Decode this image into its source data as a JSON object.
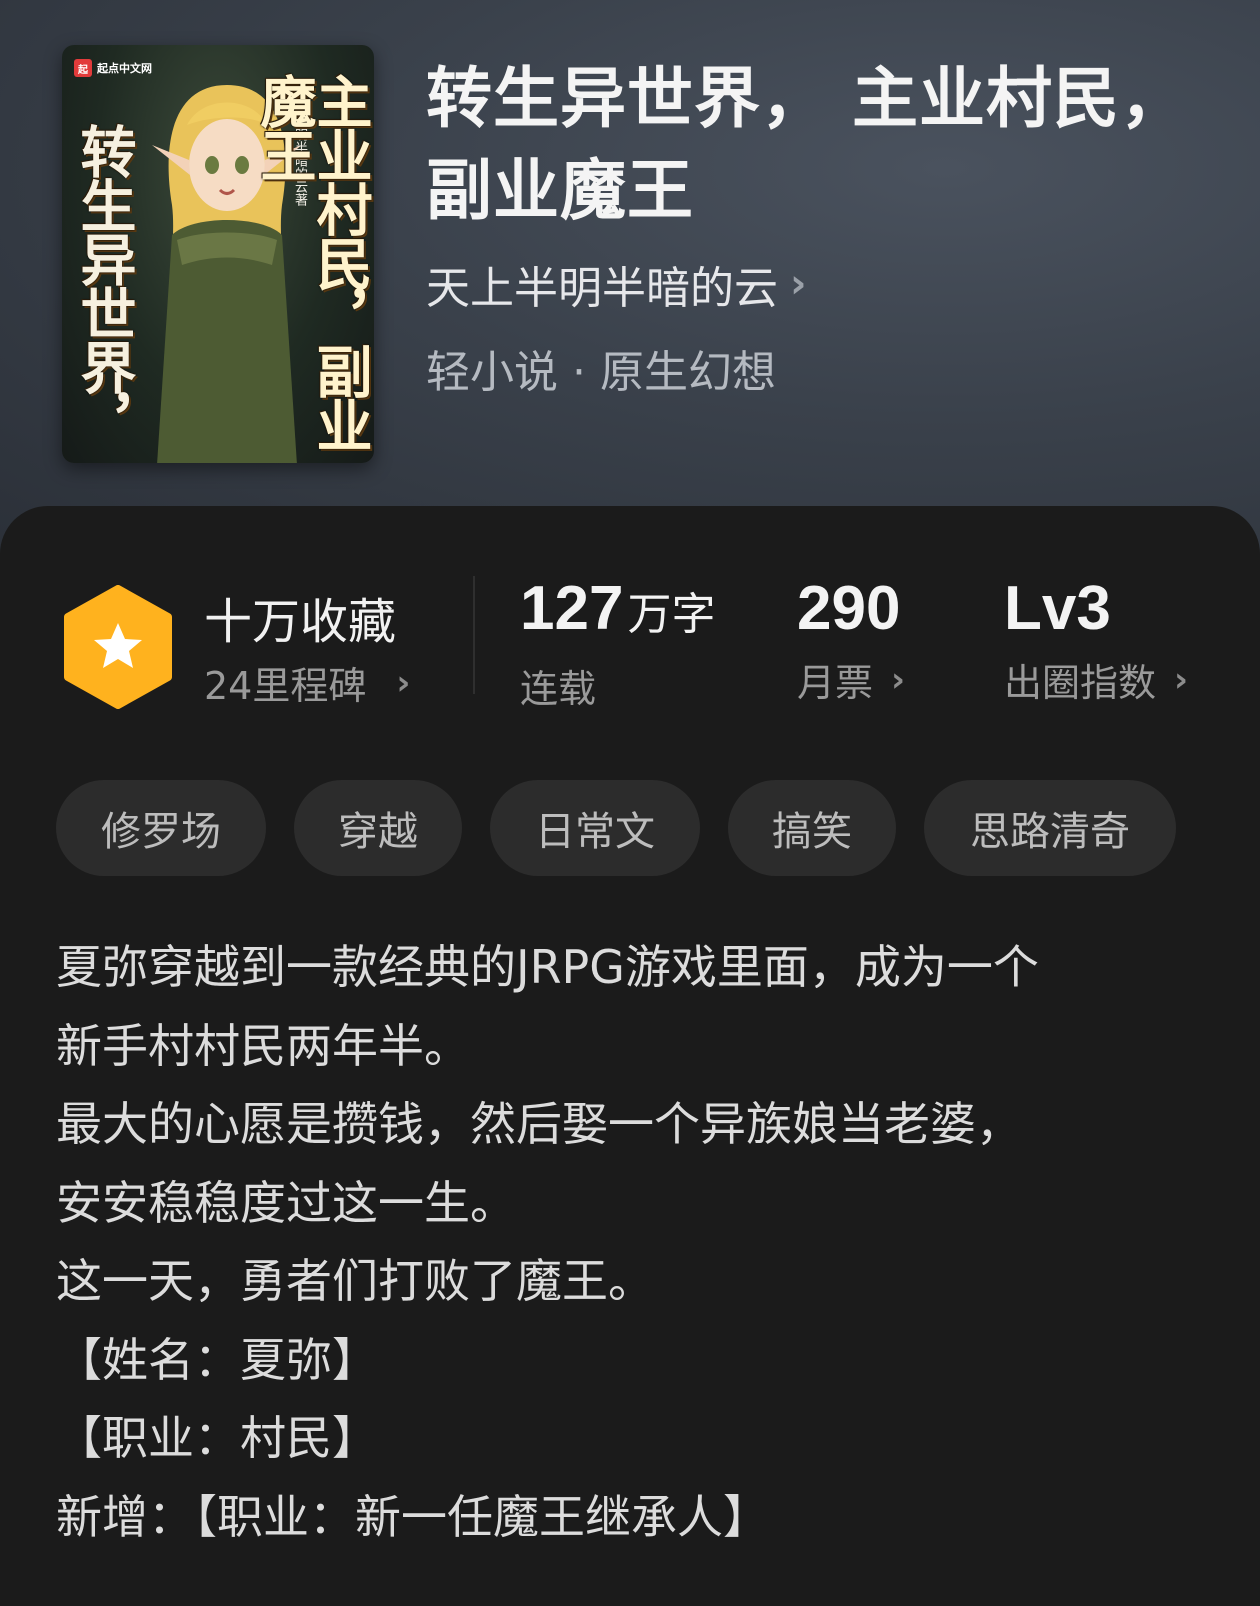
{
  "book": {
    "title_line1": "转生异世界， 主业村民，",
    "title_line2": "副业魔王",
    "author": "天上半明半暗的云",
    "genre": "轻小说 · 原生幻想"
  },
  "cover": {
    "publisher_logo": "起点中文网",
    "text_left": "转生异世界，",
    "text_right": "主业村民，副业魔王",
    "author_text": "天上半明半暗的云著"
  },
  "stats": {
    "collection_title": "十万收藏",
    "milestone": "24里程碑",
    "word_count": "127",
    "word_unit": "万字",
    "status": "连载",
    "monthly_votes": "290",
    "monthly_votes_label": "月票",
    "level": "Lv3",
    "level_label": "出圈指数"
  },
  "tags": [
    "修罗场",
    "穿越",
    "日常文",
    "搞笑",
    "思路清奇"
  ],
  "description": [
    "夏弥穿越到一款经典的JRPG游戏里面，成为一个",
    "新手村村民两年半。",
    "最大的心愿是攒钱，然后娶一个异族娘当老婆，",
    "安安稳稳度过这一生。",
    "这一天，勇者们打败了魔王。",
    "【姓名：夏弥】",
    "【职业：村民】",
    "新增：【职业：新一任魔王继承人】"
  ],
  "colors": {
    "badge": "#ffb21e",
    "panel": "#1b1b1b",
    "tag_bg": "#2c2c2c"
  },
  "icons": [
    "star-icon",
    "chevron-right-icon"
  ]
}
